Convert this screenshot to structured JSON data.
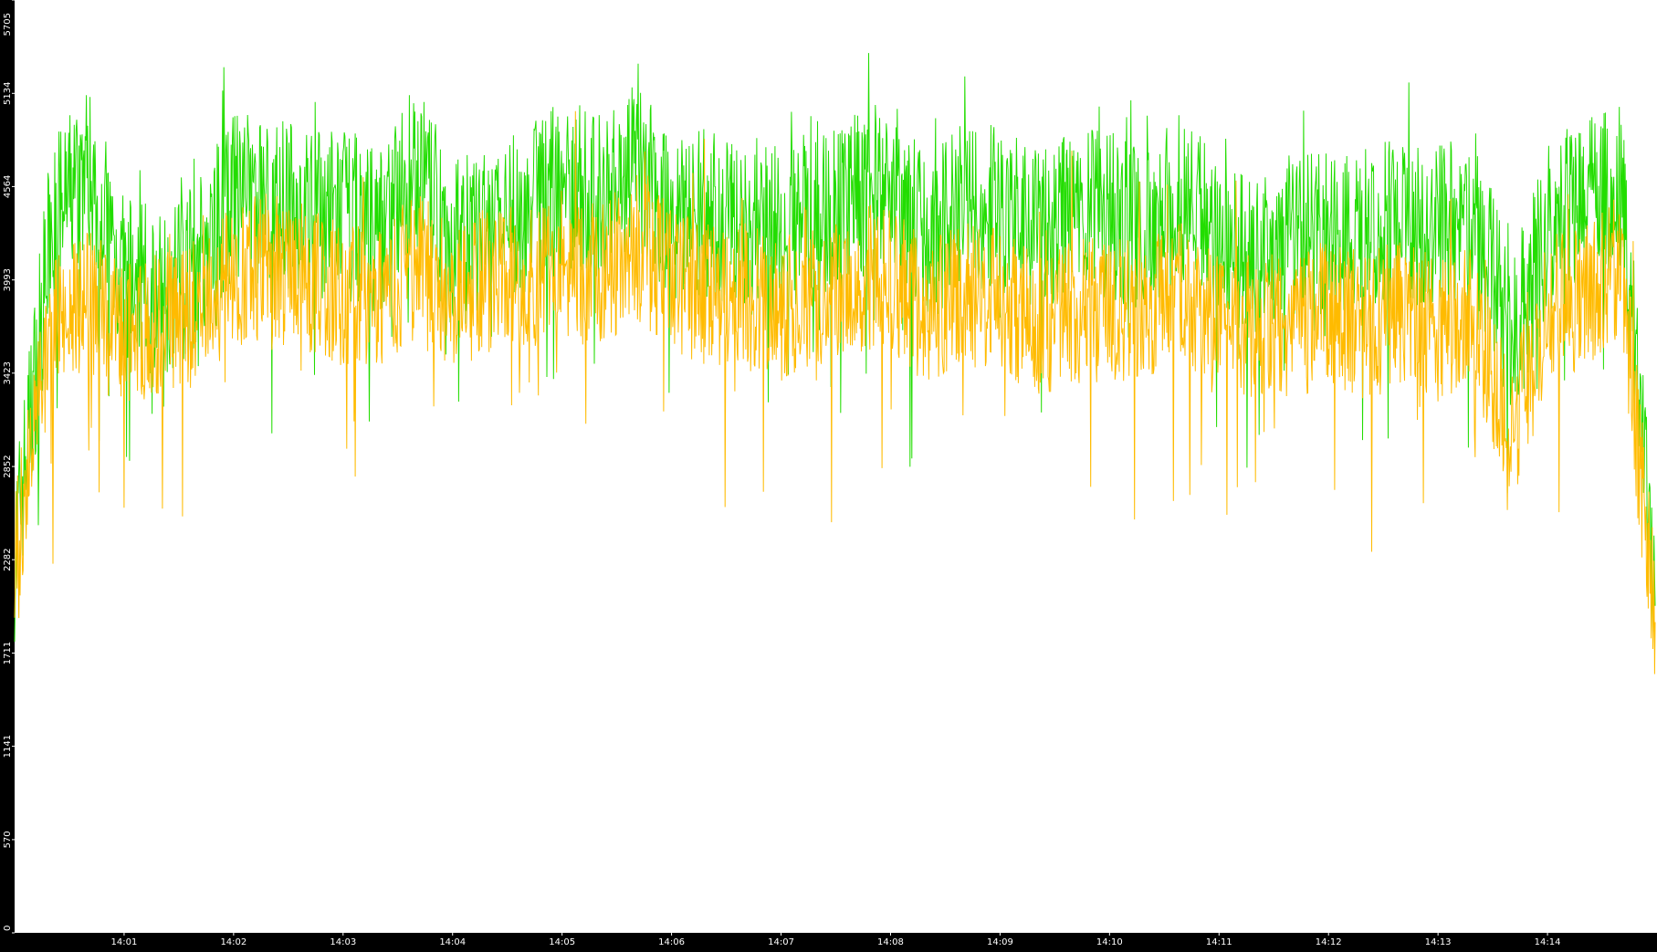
{
  "chart_data": {
    "type": "line",
    "title": "",
    "xlabel": "",
    "ylabel": "",
    "ylim": [
      0,
      5705
    ],
    "y_ticks": [
      0,
      570,
      1141,
      1711,
      2282,
      2852,
      3423,
      3993,
      4564,
      5134,
      5705
    ],
    "x_range": [
      "14:00",
      "14:15"
    ],
    "x_ticks": [
      "14:01",
      "14:02",
      "14:03",
      "14:04",
      "14:05",
      "14:06",
      "14:07",
      "14:08",
      "14:09",
      "14:10",
      "14:11",
      "14:12",
      "14:13",
      "14:14"
    ],
    "grid": false,
    "background": "#ffffff",
    "axis_color": "#000000",
    "series": [
      {
        "color": "#22dd00",
        "x": [
          "14:00:00",
          "14:00:20",
          "14:00:40",
          "14:01:00",
          "14:01:20",
          "14:01:40",
          "14:02:00",
          "14:02:20",
          "14:02:40",
          "14:03:00",
          "14:03:20",
          "14:03:40",
          "14:04:00",
          "14:04:20",
          "14:04:40",
          "14:05:00",
          "14:05:20",
          "14:05:40",
          "14:06:00",
          "14:06:20",
          "14:06:40",
          "14:07:00",
          "14:07:20",
          "14:07:40",
          "14:08:00",
          "14:08:20",
          "14:08:40",
          "14:09:00",
          "14:09:20",
          "14:09:40",
          "14:10:00",
          "14:10:20",
          "14:10:40",
          "14:11:00",
          "14:11:20",
          "14:11:40",
          "14:12:00",
          "14:12:20",
          "14:12:40",
          "14:13:00",
          "14:13:20",
          "14:13:40",
          "14:14:00",
          "14:14:20",
          "14:14:40",
          "14:14:59"
        ],
        "values": [
          2300,
          4300,
          4700,
          4000,
          3900,
          4100,
          4500,
          4500,
          4400,
          4400,
          4300,
          4700,
          4200,
          4300,
          4400,
          4600,
          4500,
          4700,
          4400,
          4400,
          4300,
          4300,
          4400,
          4500,
          4600,
          4200,
          4500,
          4400,
          4300,
          4400,
          4400,
          4300,
          4500,
          4300,
          4100,
          4300,
          4300,
          4300,
          4400,
          4300,
          4400,
          3600,
          4300,
          4500,
          4600,
          2000
        ]
      },
      {
        "color": "#ffbb00",
        "x": [
          "14:00:00",
          "14:00:20",
          "14:00:40",
          "14:01:00",
          "14:01:20",
          "14:01:40",
          "14:02:00",
          "14:02:20",
          "14:02:40",
          "14:03:00",
          "14:03:20",
          "14:03:40",
          "14:04:00",
          "14:04:20",
          "14:04:40",
          "14:05:00",
          "14:05:20",
          "14:05:40",
          "14:06:00",
          "14:06:20",
          "14:06:40",
          "14:07:00",
          "14:07:20",
          "14:07:40",
          "14:08:00",
          "14:08:20",
          "14:08:40",
          "14:09:00",
          "14:09:20",
          "14:09:40",
          "14:10:00",
          "14:10:20",
          "14:10:40",
          "14:11:00",
          "14:11:20",
          "14:11:40",
          "14:12:00",
          "14:12:20",
          "14:12:40",
          "14:13:00",
          "14:13:20",
          "14:13:40",
          "14:14:00",
          "14:14:20",
          "14:14:40",
          "14:14:59"
        ],
        "values": [
          2300,
          3700,
          3900,
          3600,
          3700,
          3800,
          4000,
          4100,
          4000,
          3900,
          3900,
          4100,
          3900,
          4000,
          4000,
          4100,
          4000,
          4200,
          4000,
          3900,
          3900,
          3800,
          3900,
          4000,
          4000,
          3800,
          3900,
          3900,
          3700,
          3800,
          3800,
          3800,
          3900,
          3700,
          3700,
          3700,
          3800,
          3700,
          3800,
          3700,
          3800,
          3000,
          3800,
          3900,
          4100,
          1900
        ]
      }
    ]
  }
}
